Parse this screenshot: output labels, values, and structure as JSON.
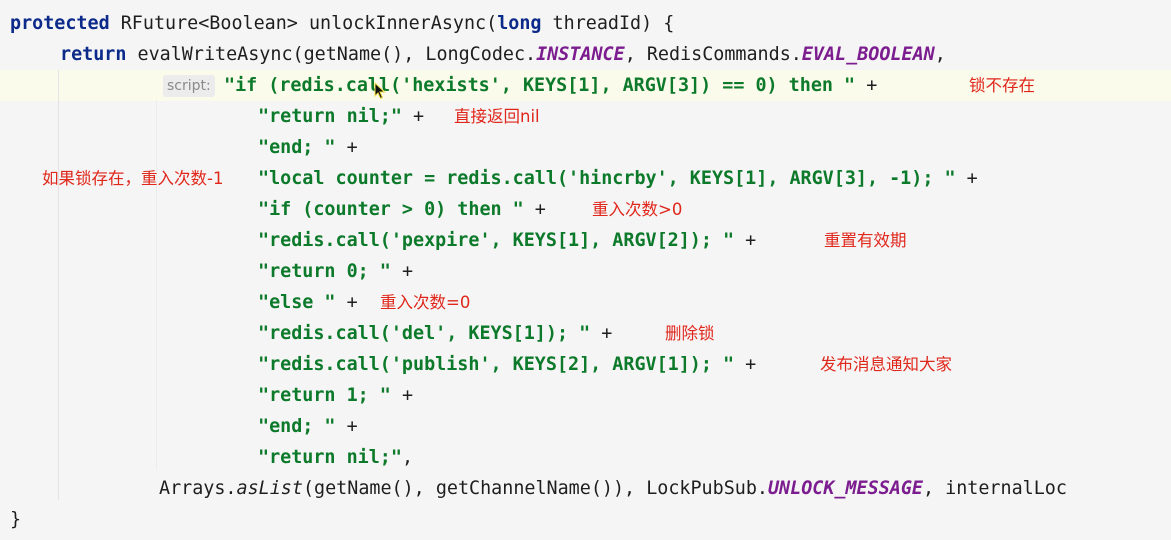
{
  "editor": {
    "hint_label": "script:",
    "lines": {
      "l1": {
        "kw1": "protected",
        "t1": " RFuture<Boolean> unlockInnerAsync(",
        "kw2": "long",
        "t2": " threadId) {"
      },
      "l2": {
        "kw1": "return",
        "t1": " evalWriteAsync(getName(), LongCodec.",
        "c1": "INSTANCE",
        "t2": ", RedisCommands.",
        "c2": "EVAL_BOOLEAN",
        "t3": ","
      },
      "l3": {
        "s1": "\"if (redis.call('hexists', KEYS[1], ARGV[3]) == 0) then \"",
        "t1": " +"
      },
      "l4": {
        "s1": "\"return nil;\"",
        "t1": " +"
      },
      "l5": {
        "s1": "\"end; \"",
        "t1": " +"
      },
      "l6": {
        "s1": "\"local counter = redis.call('hincrby', KEYS[1], ARGV[3], -1); \"",
        "t1": " +"
      },
      "l7": {
        "s1": "\"if (counter > 0) then \"",
        "t1": " +"
      },
      "l8": {
        "s1": "\"redis.call('pexpire', KEYS[1], ARGV[2]); \"",
        "t1": " +"
      },
      "l9": {
        "s1": "\"return 0; \"",
        "t1": " +"
      },
      "l10": {
        "s1": "\"else \"",
        "t1": " +"
      },
      "l11": {
        "s1": "\"redis.call('del', KEYS[1]); \"",
        "t1": " +"
      },
      "l12": {
        "s1": "\"redis.call('publish', KEYS[2], ARGV[1]); \"",
        "t1": " +"
      },
      "l13": {
        "s1": "\"return 1; \"",
        "t1": " +"
      },
      "l14": {
        "s1": "\"end; \"",
        "t1": " +"
      },
      "l15": {
        "s1": "\"return nil;\"",
        "t1": ","
      },
      "l16": {
        "t1": "Arrays.",
        "st": "asList",
        "t2": "(getName(), getChannelName()), LockPubSub.",
        "c1": "UNLOCK_MESSAGE",
        "t3": ", internalLoc"
      },
      "l17": {
        "t1": "}"
      }
    }
  },
  "annotations": {
    "a1": "锁不存在",
    "a2": "直接返回nil",
    "a3": "如果锁存在，重入次数-1",
    "a4": "重入次数>0",
    "a5": "重置有效期",
    "a6": "重入次数=0",
    "a7": "删除锁",
    "a8": "发布消息通知大家"
  },
  "colors": {
    "keyword": "#0b2a8a",
    "string": "#0c7a2a",
    "constant": "#7c1d8f",
    "annotation": "#e0271c",
    "background": "#f5f5f5"
  },
  "icons": {
    "cursor": "mouse-pointer-icon"
  }
}
